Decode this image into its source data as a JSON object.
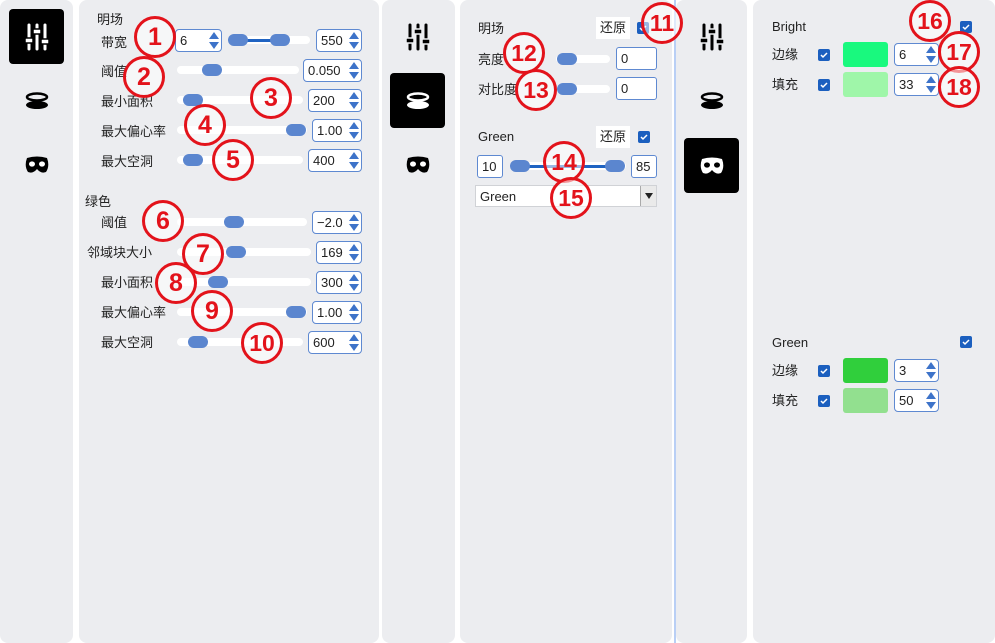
{
  "left_panel": {
    "section_brightfield": "明场",
    "rows": [
      {
        "label": "带宽",
        "min": "6",
        "max": "550"
      },
      {
        "label": "阈值",
        "value": "0.050"
      },
      {
        "label": "最小面积",
        "value": "200"
      },
      {
        "label": "最大偏心率",
        "value": "1.00"
      },
      {
        "label": "最大空洞",
        "value": "400"
      }
    ],
    "section_green": "绿色",
    "green_rows": [
      {
        "label": "阈值",
        "value": "−2.0"
      },
      {
        "label": "邻域块大小",
        "value": "169"
      },
      {
        "label": "最小面积",
        "value": "300"
      },
      {
        "label": "最大偏心率",
        "value": "1.00"
      },
      {
        "label": "最大空洞",
        "value": "600"
      }
    ]
  },
  "middle_panel": {
    "section_brightfield": "明场",
    "reset_label": "还原",
    "brightness_label": "亮度",
    "brightness_value": "0",
    "contrast_label": "对比度",
    "contrast_value": "0",
    "section_green": "Green",
    "green_reset_label": "还原",
    "range_min": "10",
    "range_max": "85",
    "colormap_selected": "Green"
  },
  "right_panel": {
    "bright_title": "Bright",
    "edge_label": "边缘",
    "edge_value": "6",
    "edge_color": "#19f97e",
    "fill_label": "填充",
    "fill_value": "33",
    "fill_color": "#9ff6a9",
    "green_title": "Green",
    "green_edge_label": "边缘",
    "green_edge_value": "3",
    "green_edge_color": "#30cf3c",
    "green_fill_label": "填充",
    "green_fill_value": "50",
    "green_fill_color": "#92e08f"
  },
  "annotations": [
    "1",
    "2",
    "3",
    "4",
    "5",
    "6",
    "7",
    "8",
    "9",
    "10",
    "11",
    "12",
    "13",
    "14",
    "15",
    "16",
    "17",
    "18"
  ],
  "icons": [
    "sliders-icon",
    "ring-icon",
    "mask-icon"
  ],
  "colors": {
    "accent": "#1b5fbf",
    "knob": "#5b86cf",
    "badge": "#e3131b",
    "panel": "#ecedf0"
  }
}
